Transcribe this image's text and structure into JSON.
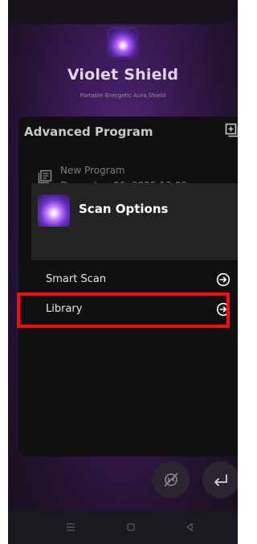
{
  "header": {
    "app_title": "Violet Shield",
    "app_subtitle": "Portable Energetic Aura Shield"
  },
  "panel": {
    "title": "Advanced Program",
    "program": {
      "name": "New Program",
      "date": "December 06, 2025 13:09"
    },
    "scan_options": {
      "label": "Scan Options",
      "items": [
        {
          "label": "Smart Scan"
        },
        {
          "label": "Library",
          "highlighted": true
        }
      ]
    }
  },
  "icons": {
    "add": "add-box-icon",
    "program": "document-list-icon",
    "arrow": "arrow-circle-right-icon",
    "fab_left": "no-touch-icon",
    "fab_right": "return-arrow-icon",
    "nav_menu": "menu-icon",
    "nav_home": "home-square-icon",
    "nav_back": "back-triangle-icon"
  },
  "colors": {
    "highlight_border": "#ff0b0b",
    "panel_bg": "#101010",
    "scan_header_bg": "#232323"
  }
}
